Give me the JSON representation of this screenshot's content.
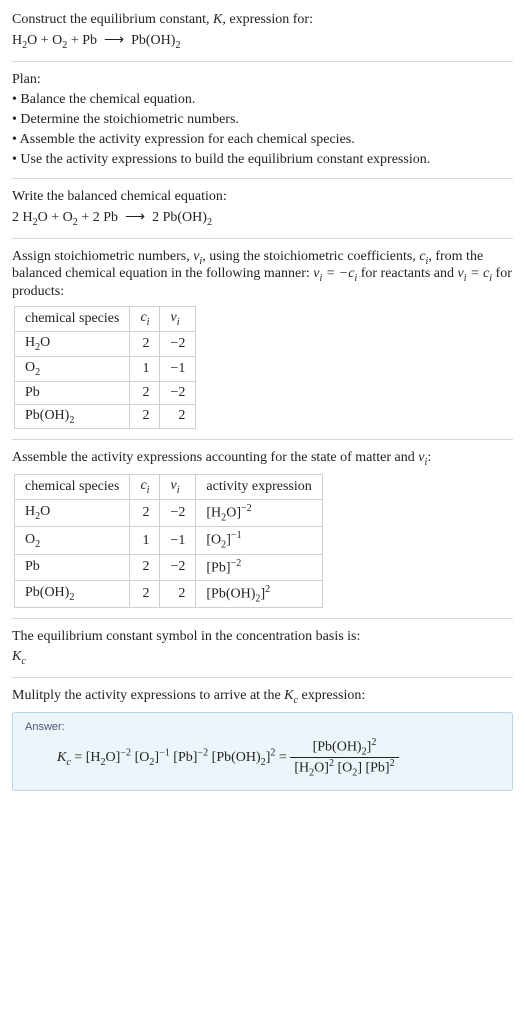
{
  "intro": {
    "line1_pre": "Construct the equilibrium constant, ",
    "line1_post": ", expression for:"
  },
  "plan": {
    "heading": "Plan:",
    "b1": "Balance the chemical equation.",
    "b2": "Determine the stoichiometric numbers.",
    "b3": "Assemble the activity expression for each chemical species.",
    "b4": "Use the activity expressions to build the equilibrium constant expression."
  },
  "balanced_heading": "Write the balanced chemical equation:",
  "stoich_text_1": "Assign stoichiometric numbers, ",
  "stoich_text_2": ", using the stoichiometric coefficients, ",
  "stoich_text_3": ", from the balanced chemical equation in the following manner: ",
  "stoich_text_4": " for reactants and ",
  "stoich_text_5": " for products:",
  "table1": {
    "h1": "chemical species",
    "rows": [
      {
        "c": "2",
        "v": "−2"
      },
      {
        "c": "1",
        "v": "−1"
      },
      {
        "c": "2",
        "v": "−2"
      },
      {
        "c": "2",
        "v": "2"
      }
    ]
  },
  "activity_text_1": "Assemble the activity expressions accounting for the state of matter and ",
  "activity_text_2": ":",
  "table2": {
    "h1": "chemical species",
    "h4": "activity expression",
    "rows": [
      {
        "c": "2",
        "v": "−2"
      },
      {
        "c": "1",
        "v": "−1"
      },
      {
        "c": "2",
        "v": "−2"
      },
      {
        "c": "2",
        "v": "2"
      }
    ]
  },
  "kc_basis_1": "The equilibrium constant symbol in the concentration basis is:",
  "mult_text_1": "Mulitply the activity expressions to arrive at the ",
  "mult_text_2": " expression:",
  "answer_label": "Answer:",
  "chart_data": {
    "type": "table",
    "species": [
      "H2O",
      "O2",
      "Pb",
      "Pb(OH)2"
    ],
    "c_i": [
      2,
      1,
      2,
      2
    ],
    "nu_i": [
      -2,
      -1,
      -2,
      2
    ],
    "activity_expression": [
      "[H2O]^-2",
      "[O2]^-1",
      "[Pb]^-2",
      "[Pb(OH)2]^2"
    ],
    "unbalanced_equation": "H2O + O2 + Pb -> Pb(OH)2",
    "balanced_equation": "2 H2O + O2 + 2 Pb -> 2 Pb(OH)2",
    "Kc_expression": "[Pb(OH)2]^2 / ([H2O]^2 [O2] [Pb]^2)"
  }
}
